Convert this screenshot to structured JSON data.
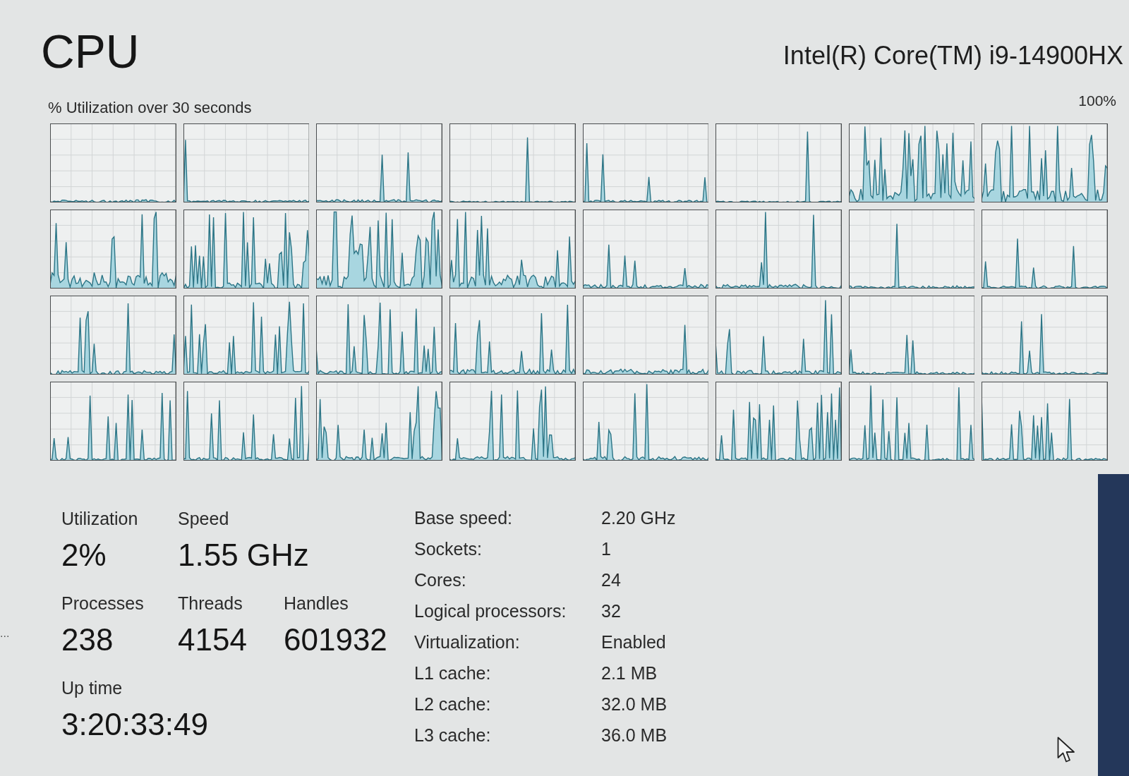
{
  "header": {
    "title": "CPU",
    "processor_name": "Intel(R) Core(TM) i9-14900HX"
  },
  "graph_panel": {
    "caption": "% Utilization over 30 seconds",
    "scale_max": "100%"
  },
  "stats": [
    [
      {
        "label": "Utilization",
        "value": "2%"
      },
      {
        "label": "Speed",
        "value": "1.55 GHz"
      }
    ],
    [
      {
        "label": "Processes",
        "value": "238"
      },
      {
        "label": "Threads",
        "value": "4154"
      },
      {
        "label": "Handles",
        "value": "601932"
      }
    ],
    [
      {
        "label": "Up time",
        "value": "3:20:33:49"
      }
    ]
  ],
  "details": [
    {
      "label": "Base speed:",
      "value": "2.20 GHz"
    },
    {
      "label": "Sockets:",
      "value": "1"
    },
    {
      "label": "Cores:",
      "value": "24"
    },
    {
      "label": "Logical processors:",
      "value": "32"
    },
    {
      "label": "Virtualization:",
      "value": "Enabled"
    },
    {
      "label": "L1 cache:",
      "value": "2.1 MB"
    },
    {
      "label": "L2 cache:",
      "value": "32.0 MB"
    },
    {
      "label": "L3 cache:",
      "value": "36.0 MB"
    }
  ],
  "left_edge_text": "..."
}
